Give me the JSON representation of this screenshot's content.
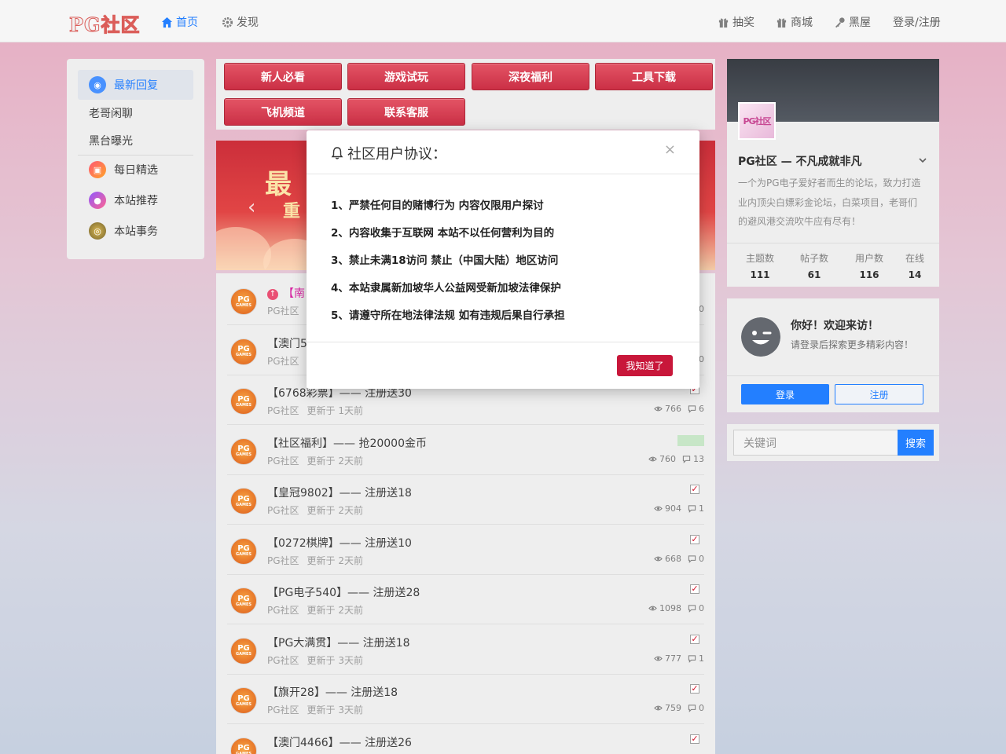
{
  "header": {
    "logo": "PG社区",
    "nav_left": [
      {
        "label": "首页",
        "icon": "home-icon",
        "active": true
      },
      {
        "label": "发现",
        "icon": "gear-icon",
        "active": false
      }
    ],
    "nav_right": [
      {
        "label": "抽奖",
        "icon": "gift-icon"
      },
      {
        "label": "商城",
        "icon": "gift-icon"
      },
      {
        "label": "黑屋",
        "icon": "key-icon"
      },
      {
        "label": "登录/注册"
      }
    ]
  },
  "sidebar": {
    "items": [
      {
        "label": "最新回复",
        "active": true
      },
      {
        "label": "老哥闲聊"
      },
      {
        "label": "黑台曝光"
      },
      {
        "label": "每日精选"
      },
      {
        "label": "本站推荐"
      },
      {
        "label": "本站事务"
      }
    ]
  },
  "buttons": [
    "新人必看",
    "游戏试玩",
    "深夜福利",
    "工具下载",
    "飞机频道",
    "联系客服"
  ],
  "banner": {
    "text1": "最",
    "text2": "重"
  },
  "posts": [
    {
      "title": "【南",
      "author": "PG社区",
      "updated": "",
      "views": "",
      "replies": "0",
      "mark": "top"
    },
    {
      "title": "【澳门5",
      "author": "PG社区",
      "updated": "",
      "views": "",
      "replies": "0",
      "mark": "none"
    },
    {
      "title": "【6768彩票】—— 注册送30",
      "author": "PG社区",
      "updated": "更新于 1天前",
      "views": "766",
      "replies": "6",
      "mark": "check"
    },
    {
      "title": "【社区福利】—— 抢20000金币",
      "author": "PG社区",
      "updated": "更新于 2天前",
      "views": "760",
      "replies": "13",
      "mark": "hot"
    },
    {
      "title": "【皇冠9802】—— 注册送18",
      "author": "PG社区",
      "updated": "更新于 2天前",
      "views": "904",
      "replies": "1",
      "mark": "check"
    },
    {
      "title": "【0272棋牌】—— 注册送10",
      "author": "PG社区",
      "updated": "更新于 2天前",
      "views": "668",
      "replies": "0",
      "mark": "check"
    },
    {
      "title": "【PG电子540】—— 注册送28",
      "author": "PG社区",
      "updated": "更新于 2天前",
      "views": "1098",
      "replies": "0",
      "mark": "check"
    },
    {
      "title": "【PG大满贯】—— 注册送18",
      "author": "PG社区",
      "updated": "更新于 3天前",
      "views": "777",
      "replies": "1",
      "mark": "check"
    },
    {
      "title": "【旗开28】—— 注册送18",
      "author": "PG社区",
      "updated": "更新于 3天前",
      "views": "759",
      "replies": "0",
      "mark": "check"
    },
    {
      "title": "【澳门4466】—— 注册送26",
      "author": "",
      "updated": "",
      "views": "",
      "replies": "",
      "mark": "check"
    }
  ],
  "profile": {
    "avatar_text": "PG社区",
    "name": "PG社区 — 不凡成就非凡",
    "desc": "一个为PG电子爱好者而生的论坛，致力打造业内顶尖白嫖彩金论坛，白菜项目，老哥们的避风港交流吹牛应有尽有！",
    "stats": [
      {
        "label": "主题数",
        "value": "111"
      },
      {
        "label": "帖子数",
        "value": "61"
      },
      {
        "label": "用户数",
        "value": "116"
      },
      {
        "label": "在线",
        "value": "14"
      }
    ]
  },
  "welcome": {
    "title": "你好！欢迎来访！",
    "subtitle": "请登录后探索更多精彩内容！",
    "login": "登录",
    "register": "注册"
  },
  "search": {
    "placeholder": "关键词",
    "button": "搜索"
  },
  "modal": {
    "title": "社区用户协议：",
    "close": "×",
    "rules": [
      "1、严禁任何目的赌博行为 内容仅限用户探讨",
      "2、内容收集于互联网 本站不以任何营利为目的",
      "3、禁止未满18访问 禁止（中国大陆）地区访问",
      "4、本站隶属新加坡华人公益网受新加坡法律保护",
      "5、请遵守所在地法律法规 如有违规后果自行承担"
    ],
    "ok": "我知道了"
  },
  "colors": {
    "accent": "#1677ff",
    "brand_red": "#c8233a",
    "modal_button": "#c8173a"
  }
}
